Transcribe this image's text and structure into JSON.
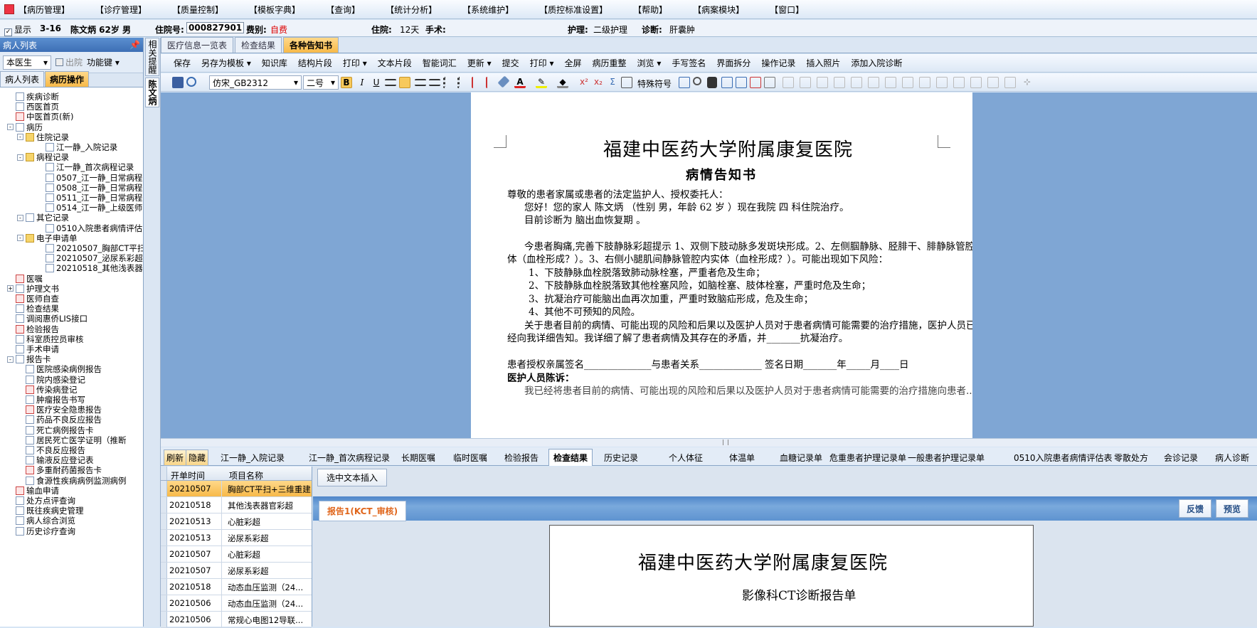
{
  "menubar": [
    "【病历管理】",
    "【诊疗管理】",
    "【质量控制】",
    "【模板字典】",
    "【查询】",
    "【统计分析】",
    "【系统维护】",
    "【质控标准设置】",
    "【帮助】",
    "【病案模块】",
    "【窗口】"
  ],
  "patient": {
    "show_label": "显示",
    "bed": "3-16",
    "name_age_sex": "陈文炳 62岁 男",
    "inpatient_no_label": "住院号:",
    "inpatient_no": "000827901",
    "fee_label": "费别:",
    "fee": "自费",
    "stay_label": "住院:",
    "stay": "12天",
    "surgery_label": "手术:",
    "nursing_label": "护理:",
    "nursing": "二级护理",
    "diagnosis_label": "诊断:",
    "diagnosis": "肝囊肿"
  },
  "leftpanel": {
    "title": "病人列表",
    "pin": "ª",
    "doctor_select": "本医生",
    "discharged_label": "出院",
    "function_key": "功能键",
    "tabs": [
      "病人列表",
      "病历操作"
    ],
    "tree": [
      {
        "label": "疾病诊断",
        "level": 1,
        "icon": "doc"
      },
      {
        "label": "西医首页",
        "level": 1,
        "icon": "doc"
      },
      {
        "label": "中医首页(新)",
        "level": 1,
        "icon": "red"
      },
      {
        "label": "病历",
        "level": 1,
        "icon": "doc",
        "expander": "-"
      },
      {
        "label": "住院记录",
        "level": 2,
        "icon": "folder",
        "expander": "-"
      },
      {
        "label": "江一静_入院记录",
        "level": 3,
        "icon": "doc"
      },
      {
        "label": "病程记录",
        "level": 2,
        "icon": "folder",
        "expander": "-"
      },
      {
        "label": "江一静_首次病程记录",
        "level": 3,
        "icon": "doc"
      },
      {
        "label": "0507_江一静_日常病程",
        "level": 3,
        "icon": "doc"
      },
      {
        "label": "0508_江一静_日常病程",
        "level": 3,
        "icon": "doc"
      },
      {
        "label": "0511_江一静_日常病程",
        "level": 3,
        "icon": "doc"
      },
      {
        "label": "0514_江一静_上级医师",
        "level": 3,
        "icon": "doc"
      },
      {
        "label": "其它记录",
        "level": 2,
        "icon": "doc",
        "expander": "-"
      },
      {
        "label": "0510入院患者病情评估",
        "level": 3,
        "icon": "doc"
      },
      {
        "label": "电子申请单",
        "level": 2,
        "icon": "folder",
        "expander": "-"
      },
      {
        "label": "20210507_胸部CT平扫",
        "level": 3,
        "icon": "doc"
      },
      {
        "label": "20210507_泌尿系彩超",
        "level": 3,
        "icon": "doc"
      },
      {
        "label": "20210518_其他浅表器",
        "level": 3,
        "icon": "doc"
      },
      {
        "label": "医嘱",
        "level": 1,
        "icon": "red"
      },
      {
        "label": "护理文书",
        "level": 1,
        "icon": "doc",
        "expander": "+"
      },
      {
        "label": "医师自查",
        "level": 1,
        "icon": "red"
      },
      {
        "label": "检查结果",
        "level": 1,
        "icon": "doc"
      },
      {
        "label": "调阅惠侨LIS接口",
        "level": 1,
        "icon": "doc"
      },
      {
        "label": "检验报告",
        "level": 1,
        "icon": "red"
      },
      {
        "label": "科室质控员审核",
        "level": 1,
        "icon": "doc"
      },
      {
        "label": "手术申请",
        "level": 1,
        "icon": "doc"
      },
      {
        "label": "报告卡",
        "level": 1,
        "icon": "doc",
        "expander": "-"
      },
      {
        "label": "医院感染病例报告",
        "level": 2,
        "icon": "doc"
      },
      {
        "label": "院内感染登记",
        "level": 2,
        "icon": "doc"
      },
      {
        "label": "传染病登记",
        "level": 2,
        "icon": "red"
      },
      {
        "label": "肿瘤报告书写",
        "level": 2,
        "icon": "doc"
      },
      {
        "label": "医疗安全隐患报告",
        "level": 2,
        "icon": "red"
      },
      {
        "label": "药品不良反应报告",
        "level": 2,
        "icon": "doc"
      },
      {
        "label": "死亡病例报告卡",
        "level": 2,
        "icon": "doc"
      },
      {
        "label": "居民死亡医学证明（推断",
        "level": 2,
        "icon": "doc"
      },
      {
        "label": "不良反应报告",
        "level": 2,
        "icon": "doc"
      },
      {
        "label": "输液反应登记表",
        "level": 2,
        "icon": "doc"
      },
      {
        "label": "多重耐药菌报告卡",
        "level": 2,
        "icon": "red"
      },
      {
        "label": "食源性疾病病例监测病例",
        "level": 2,
        "icon": "doc"
      },
      {
        "label": "输血申请",
        "level": 1,
        "icon": "red"
      },
      {
        "label": "处方点评查询",
        "level": 1,
        "icon": "doc"
      },
      {
        "label": "既往疾病史管理",
        "level": 1,
        "icon": "doc"
      },
      {
        "label": "病人综合浏览",
        "level": 1,
        "icon": "doc"
      },
      {
        "label": "历史诊疗查询",
        "level": 1,
        "icon": "doc"
      }
    ]
  },
  "vtabs": [
    "相关提醒",
    "陈文炳"
  ],
  "doctabs": [
    "医疗信息一览表",
    "检查结果",
    "各种告知书"
  ],
  "toolbar1": [
    "保存",
    "另存为模板 ▾",
    "知识库",
    "结构片段",
    "打印 ▾",
    "文本片段",
    "智能词汇",
    "更新 ▾",
    "提交",
    "打印 ▾",
    "全屏",
    "病历重整",
    "浏览 ▾",
    "手写签名",
    "界面拆分",
    "操作记录",
    "插入照片",
    "添加入院诊断"
  ],
  "toolbar2": {
    "font": "仿宋_GB2312",
    "size": "二号",
    "special_chars": "特殊符号"
  },
  "document": {
    "hospital": "福建中医药大学附属康复医院",
    "title": "病情告知书",
    "l1": "尊敬的患者家属或患者的法定监护人、授权委托人：",
    "l2": "您好！您的家人  陈文炳  （性别  男，年龄  62 岁  ）现在我院  四  科住院治疗。",
    "l3": "目前诊断为    脑出血恢复期                                                             。",
    "l4": "今患者胸痛,完善下肢静脉彩超提示 1、双侧下肢动脉多发斑块形成。2、左侧腘静脉、胫腓干、腓静脉管腔内实",
    "l5": "体（血栓形成？）。3、右侧小腿肌间静脉管腔内实体（血栓形成？）。可能出现如下风险：",
    "l6": "1、下肢静脉血栓脱落致肺动脉栓塞，严重者危及生命；",
    "l7": "2、下肢静脉血栓脱落致其他栓塞风险，如脑栓塞、肢体栓塞，严重时危及生命；",
    "l8": "3、抗凝治疗可能脑出血再次加重，严重时致脑疝形成，危及生命；",
    "l9": "4、其他不可预知的风险。",
    "l10": "关于患者目前的病情、可能出现的风险和后果以及医护人员对于患者病情可能需要的治疗措施，医护人员已",
    "l11": "经向我详细告知。我详细了解了患者病情及其存在的矛盾，并_______抗凝治疗。",
    "l12": "患者授权亲属签名______________与患者关系_____________     签名日期_______年_____月____日",
    "l13": "医护人员陈诉：",
    "l14": "我已经将患者目前的病情、可能出现的风险和后果以及医护人员对于患者病情可能需要的治疗措施向患者..."
  },
  "bottom": {
    "refresh": "刷新",
    "hide": "隐藏",
    "tabs": [
      "江一静_入院记录",
      "江一静_首次病程记录",
      "长期医嘱",
      "临时医嘱",
      "检验报告",
      "检查结果",
      "历史记录",
      "个人体征",
      "体温单",
      "血糖记录单",
      "危重患者护理记录单",
      "一般患者护理记录单",
      "0510入院患者病情评估表",
      "零散处方",
      "会诊记录",
      "病人诊断"
    ],
    "active_tab": "检查结果"
  },
  "labtable": {
    "headers": [
      "开单时间",
      "项目名称"
    ],
    "rows": [
      [
        "20210507",
        "胸部CT平扫+三维重建"
      ],
      [
        "20210518",
        "其他浅表器官彩超"
      ],
      [
        "20210513",
        "心脏彩超"
      ],
      [
        "20210513",
        "泌尿系彩超"
      ],
      [
        "20210507",
        "心脏彩超"
      ],
      [
        "20210507",
        "泌尿系彩超"
      ],
      [
        "20210518",
        "动态血压监测（24..."
      ],
      [
        "20210506",
        "动态血压监测（24..."
      ],
      [
        "20210506",
        "常规心电图12导联..."
      ]
    ]
  },
  "report": {
    "insert_button": "选中文本插入",
    "tab": "报告1(KCT_审核)",
    "feedback": "反馈",
    "preview": "预览",
    "hospital": "福建中医药大学附属康复医院",
    "subtitle": "影像科CT诊断报告单"
  },
  "colors": {
    "accent_tab": "#f7b948",
    "header_blue": "#3d6fb5",
    "editor_bg": "#7fa6d4"
  }
}
